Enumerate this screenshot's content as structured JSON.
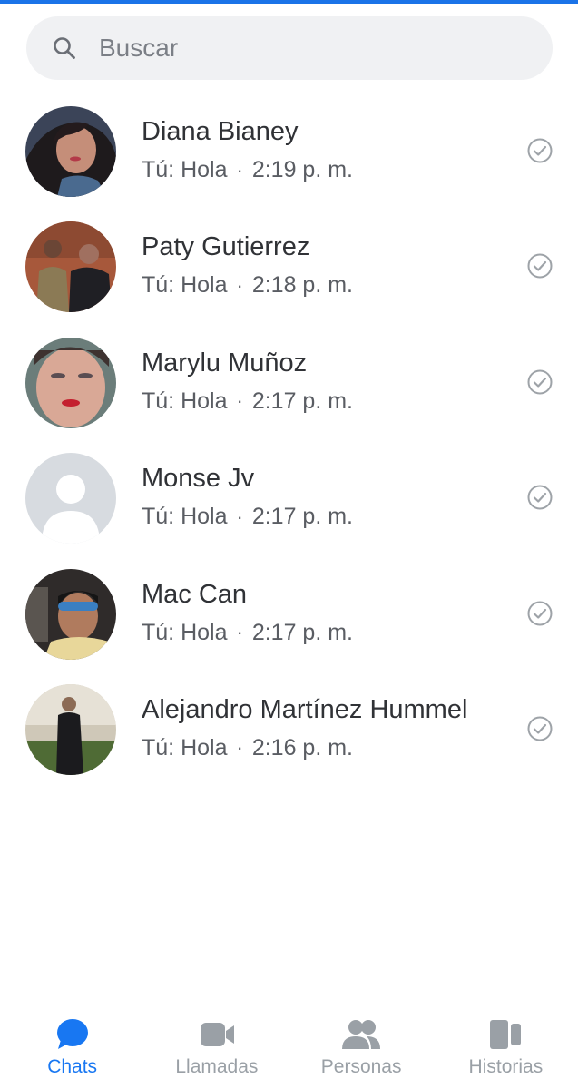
{
  "search": {
    "placeholder": "Buscar"
  },
  "chats": [
    {
      "name": "Diana Bianey",
      "preview": "Tú: Hola",
      "time": "2:19 p. m."
    },
    {
      "name": "Paty Gutierrez",
      "preview": "Tú: Hola",
      "time": "2:18 p. m."
    },
    {
      "name": "Marylu Muñoz",
      "preview": "Tú: Hola",
      "time": "2:17 p. m."
    },
    {
      "name": "Monse Jv",
      "preview": "Tú: Hola",
      "time": "2:17 p. m."
    },
    {
      "name": "Mac Can",
      "preview": "Tú: Hola",
      "time": "2:17 p. m."
    },
    {
      "name": "Alejandro Martínez Hummel",
      "preview": "Tú: Hola",
      "time": "2:16 p. m."
    }
  ],
  "separator": "·",
  "nav": [
    {
      "label": "Chats",
      "icon": "chat-bubble-icon",
      "active": true
    },
    {
      "label": "Llamadas",
      "icon": "video-camera-icon",
      "active": false
    },
    {
      "label": "Personas",
      "icon": "people-icon",
      "active": false
    },
    {
      "label": "Historias",
      "icon": "stories-icon",
      "active": false
    }
  ],
  "colors": {
    "accent": "#1877f2",
    "inactive": "#9aa0a6",
    "searchBg": "#f0f1f3"
  }
}
